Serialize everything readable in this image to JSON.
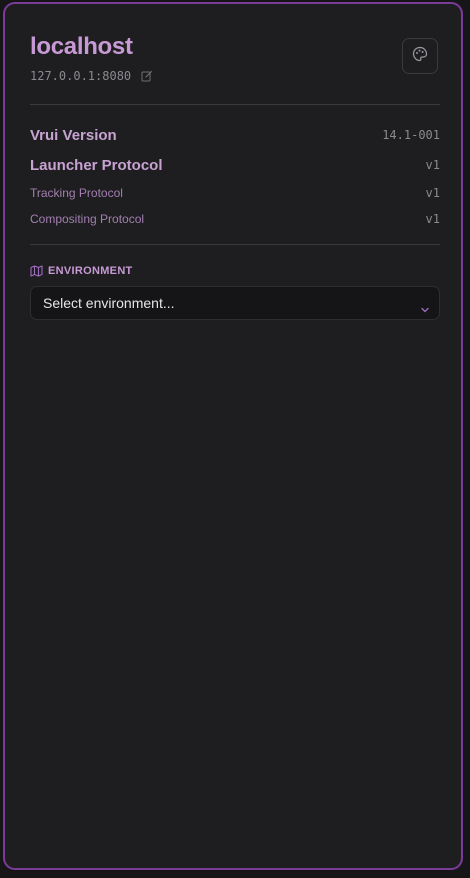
{
  "host": {
    "name": "localhost",
    "address": "127.0.0.1:8080"
  },
  "versions": [
    {
      "label": "Vrui Version",
      "value": "14.1-001"
    },
    {
      "label": "Launcher Protocol",
      "value": "v1"
    },
    {
      "label": "Tracking Protocol",
      "value": "v1"
    },
    {
      "label": "Compositing Protocol",
      "value": "v1"
    }
  ],
  "environment": {
    "heading": "ENVIRONMENT",
    "selected": "Select environment..."
  },
  "icons": {
    "edit": "edit-icon",
    "palette": "palette-icon",
    "environment": "map-icon",
    "dropdown": "chevron-down-icon"
  },
  "colors": {
    "accent": "#c79ad6",
    "border": "#7b3b98",
    "panel_bg": "#1e1e20"
  }
}
